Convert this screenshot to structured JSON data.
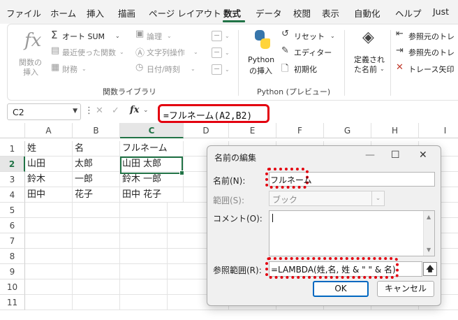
{
  "menu": {
    "items": [
      "ファイル",
      "ホーム",
      "挿入",
      "描画",
      "ページ レイアウト",
      "数式",
      "データ",
      "校閲",
      "表示",
      "自動化",
      "ヘルプ",
      "Just"
    ],
    "active": "数式"
  },
  "ribbon": {
    "function_library": {
      "insert_function_label1": "関数の",
      "insert_function_label2": "挿入",
      "autosum": "オート SUM",
      "recent": "最近使った関数",
      "financial": "財務",
      "logical": "論理",
      "text": "文字列操作",
      "datetime": "日付/時刻",
      "group_label": "関数ライブラリ"
    },
    "python": {
      "insert_label1": "Python",
      "insert_label2": "の挿入",
      "reset": "リセット",
      "editor": "エディター",
      "initialize": "初期化",
      "group_label": "Python (プレビュー)"
    },
    "defined_names": {
      "label1": "定義され",
      "label2": "た名前"
    },
    "auditing": {
      "trace_precedents": "参照元のトレ",
      "trace_dependents": "参照先のトレ",
      "remove_arrows": "トレース矢印"
    }
  },
  "formula_bar": {
    "name_box": "C2",
    "fx": "fx",
    "formula": "=フルネーム(A2,B2)"
  },
  "grid": {
    "columns": [
      "A",
      "B",
      "C",
      "D",
      "E",
      "F",
      "G",
      "H",
      "I"
    ],
    "selected_column": "C",
    "rows": [
      "1",
      "2",
      "3",
      "4",
      "5",
      "6",
      "7",
      "8",
      "9",
      "10",
      "11"
    ],
    "selected_row": "2",
    "cells": [
      [
        "姓",
        "名",
        "フルネーム"
      ],
      [
        "山田",
        "太郎",
        "山田 太郎"
      ],
      [
        "鈴木",
        "一郎",
        "鈴木 一郎"
      ],
      [
        "田中",
        "花子",
        "田中 花子"
      ]
    ]
  },
  "dialog": {
    "title": "名前の編集",
    "name_label": "名前(N):",
    "name_value": "フルネーム",
    "scope_label": "範囲(S):",
    "scope_value": "ブック",
    "comment_label": "コメント(O):",
    "refers_label": "参照範囲(R):",
    "refers_value": "=LAMBDA(姓,名, 姓 & \" \" & 名)",
    "ok": "OK",
    "cancel": "キャンセル",
    "minimize": "—",
    "maximize": "☐",
    "close": "✕"
  },
  "colors": {
    "excel_green": "#217346",
    "highlight_red": "#e3000f",
    "ok_border": "#0067c0"
  }
}
